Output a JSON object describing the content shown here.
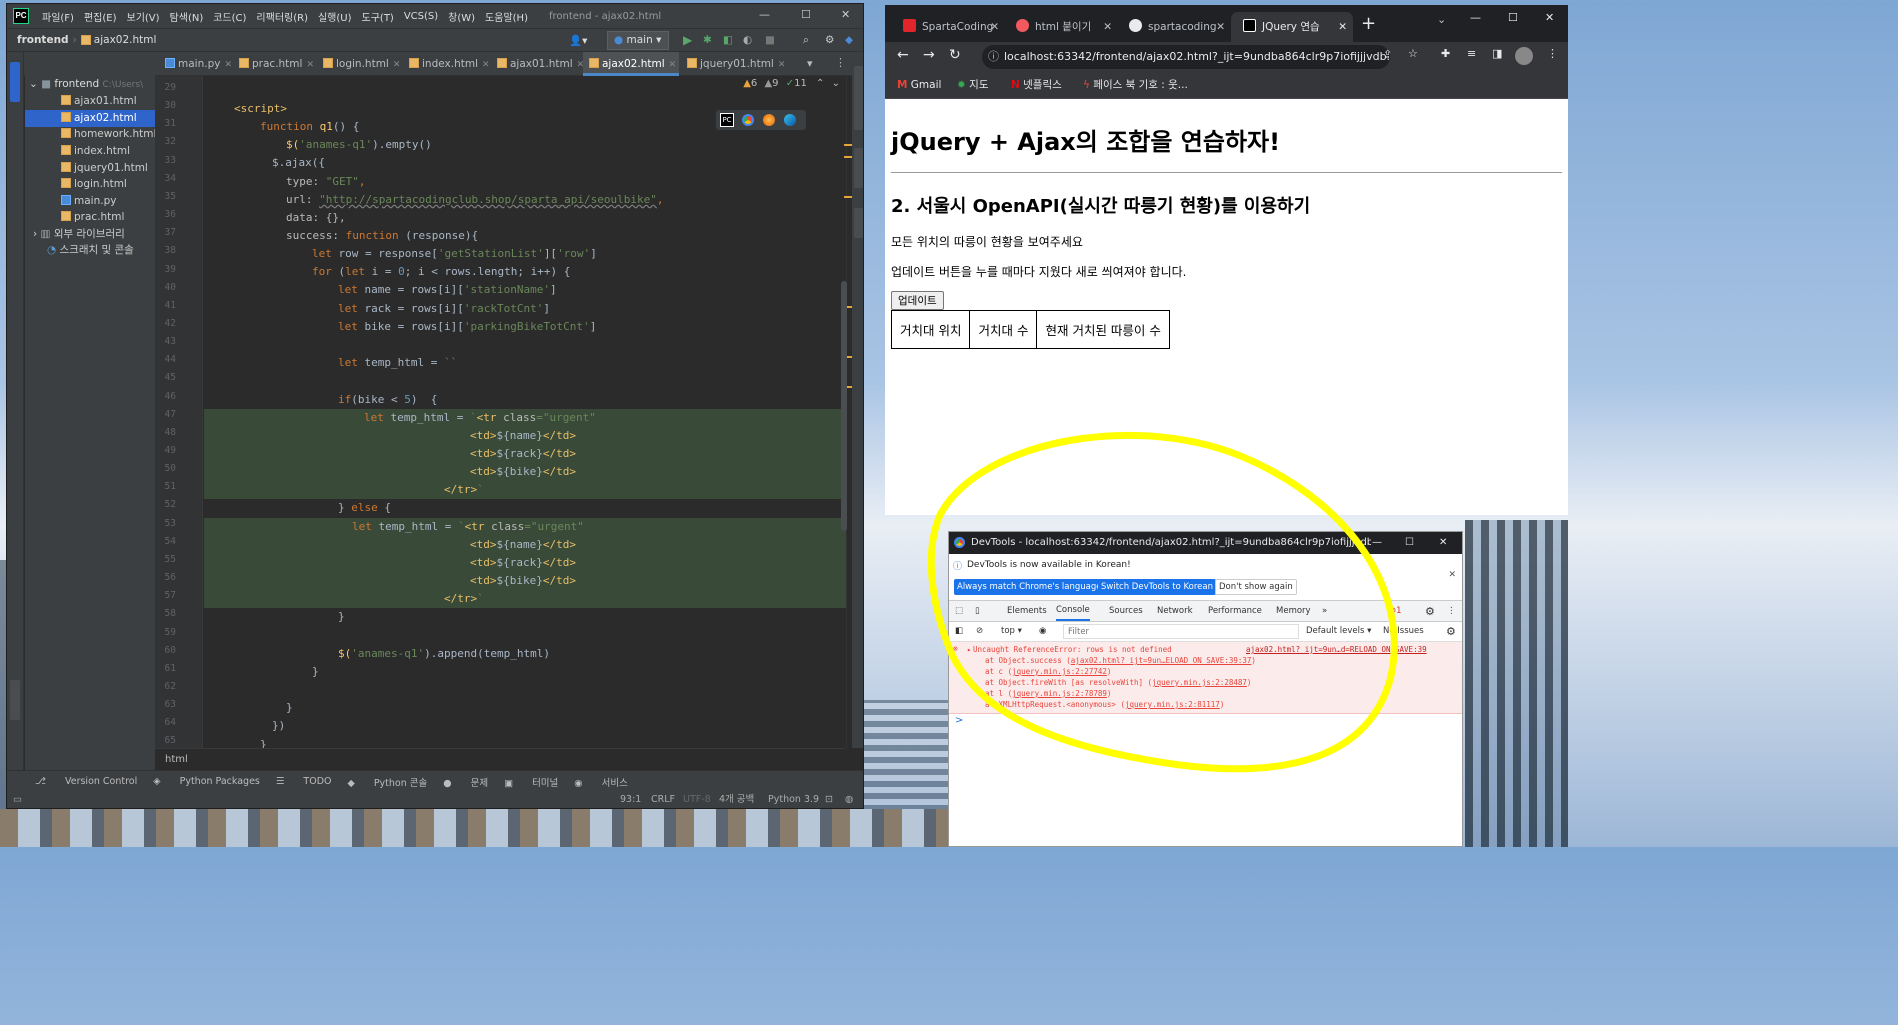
{
  "ide": {
    "menu": [
      "파일(F)",
      "편집(E)",
      "보기(V)",
      "탐색(N)",
      "코드(C)",
      "리팩터링(R)",
      "실행(U)",
      "도구(T)",
      "VCS(S)",
      "창(W)",
      "도움말(H)"
    ],
    "window_title": "frontend - ajax02.html",
    "nav": {
      "project": "frontend",
      "file": "ajax02.html",
      "run_config": "main"
    },
    "tabs": [
      {
        "label": "main.py",
        "py": true
      },
      {
        "label": "prac.html"
      },
      {
        "label": "login.html"
      },
      {
        "label": "index.html"
      },
      {
        "label": "ajax01.html"
      },
      {
        "label": "ajax02.html",
        "active": true
      },
      {
        "label": "jquery01.html"
      }
    ],
    "inspections": {
      "warnings": "6",
      "weak": "9",
      "typos": "11"
    },
    "project_tree": {
      "root": "frontend",
      "root_path": "C:\\Users\\",
      "files": [
        "ajax01.html",
        "ajax02.html",
        "homework.html",
        "index.html",
        "jquery01.html",
        "login.html",
        "main.py",
        "prac.html"
      ],
      "selected": "ajax02.html",
      "external": "외부 라이브러리",
      "scratch": "스크래치 및 콘솔"
    },
    "line_numbers": [
      "29",
      "30",
      "31",
      "32",
      "33",
      "34",
      "35",
      "36",
      "37",
      "38",
      "39",
      "40",
      "41",
      "42",
      "43",
      "44",
      "45",
      "46",
      "47",
      "48",
      "49",
      "50",
      "51",
      "52",
      "53",
      "54",
      "55",
      "56",
      "57",
      "58",
      "59",
      "60",
      "61",
      "62",
      "63",
      "64",
      "65"
    ],
    "code": {
      "l30": "<script>",
      "l31_kw": "function",
      "l31_fn": "q1",
      "l31_rest": "() {",
      "l32_a": "$(",
      "l32_s": "'anames-q1'",
      "l32_b": ").empty()",
      "l33": "$.ajax({",
      "l34_k": "type: ",
      "l34_v": "\"GET\"",
      "l34_c": ",",
      "l35_k": "url: ",
      "l35_v": "\"http://spartacodingclub.shop/sparta_api/seoulbike\"",
      "l35_c": ",",
      "l36": "data: {},",
      "l37_k": "success: ",
      "l37_kw": "function",
      "l37_rest": " (response){",
      "l38_kw": "let",
      "l38_a": " row = response[",
      "l38_s1": "'getStationList'",
      "l38_b": "][",
      "l38_s2": "'row'",
      "l38_c": "]",
      "l39_kw": "for",
      "l39_a": " (",
      "l39_kw2": "let",
      "l39_b": " i = ",
      "l39_n": "0",
      "l39_c": "; i < rows.length; i++) {",
      "l40_kw": "let",
      "l40_a": " name = rows[i][",
      "l40_s": "'stationName'",
      "l40_c": "]",
      "l41_kw": "let",
      "l41_a": " rack = rows[i][",
      "l41_s": "'rackTotCnt'",
      "l41_c": "]",
      "l42_kw": "let",
      "l42_a": " bike = rows[i][",
      "l42_s": "'parkingBikeTotCnt'",
      "l42_c": "]",
      "l44_kw": "let",
      "l44_a": " temp_html = ",
      "l44_s": "``",
      "l46_kw": "if",
      "l46_a": "(bike < ",
      "l46_n": "5",
      "l46_c": ")  {",
      "l47_kw": "let",
      "l47_a": " temp_html = ",
      "l47_q": "`",
      "l47_t": "<tr ",
      "l47_at": "class",
      "l47_v": "=\"urgent\"",
      "l48_t1": "<td>",
      "l48_v": "${name}",
      "l48_t2": "</td>",
      "l49_t1": "<td>",
      "l49_v": "${rack}",
      "l49_t2": "</td>",
      "l50_t1": "<td>",
      "l50_v": "${bike}",
      "l50_t2": "</td>",
      "l51_t": "</tr>",
      "l51_q": "`",
      "l52_a": "} ",
      "l52_kw": "else",
      "l52_b": " {",
      "l53_kw": "let",
      "l53_a": " temp_html = ",
      "l53_q": "`",
      "l53_t": "<tr ",
      "l53_at": "class",
      "l53_v": "=\"urgent\"",
      "l54_t1": "<td>",
      "l54_v": "${name}",
      "l54_t2": "</td>",
      "l55_t1": "<td>",
      "l55_v": "${rack}",
      "l55_t2": "</td>",
      "l56_t1": "<td>",
      "l56_v": "${bike}",
      "l56_t2": "</td>",
      "l57_t": "</tr>",
      "l57_q": "`",
      "l58": "}",
      "l60_a": "$(",
      "l60_s": "'anames-q1'",
      "l60_b": ").append(temp_html)",
      "l61": "}",
      "l63": "}",
      "l64": "})",
      "l65": "}"
    },
    "breadcrumb": "html",
    "tool_windows": [
      "Version Control",
      "Python Packages",
      "TODO",
      "Python 콘솔",
      "문제",
      "터미널",
      "서비스"
    ],
    "status": {
      "position": "93:1",
      "line_sep": "CRLF",
      "encoding": "UTF-8",
      "indent": "4개 공백",
      "interpreter": "Python 3.9"
    }
  },
  "browser": {
    "tabs": [
      {
        "label": "SpartaCoding",
        "color": "#e0262b"
      },
      {
        "label": "html 붙이기",
        "color": "#f25a60"
      },
      {
        "label": "spartacoding",
        "color": "#e8eaed"
      },
      {
        "label": "JQuery 연습",
        "color": "#000000",
        "active": true
      }
    ],
    "url": "localhost:63342/frontend/ajax02.html?_ijt=9undba864clr9p7iofijjjvdb...",
    "bookmarks": [
      "Gmail",
      "지도",
      "넷플릭스",
      "페이스 북 기호 : 웃..."
    ],
    "page": {
      "h1": "jQuery + Ajax의 조합을 연습하자!",
      "h2": "2. 서울시 OpenAPI(실시간 따릉기 현황)를 이용하기",
      "p1": "모든 위치의 따릉이 현황을 보여주세요",
      "p2": "업데이트 버튼을 누를 때마다 지웠다 새로 씌여져야 합니다.",
      "button": "업데이트",
      "table_headers": [
        "거치대 위치",
        "거치대 수",
        "현재 거치된 따릉이 수"
      ]
    }
  },
  "devtools": {
    "title": "DevTools - localhost:63342/frontend/ajax02.html?_ijt=9undba864clr9p7iofijjjvdbu&...",
    "infobar": "DevTools is now available in Korean!",
    "btn_match": "Always match Chrome's language",
    "btn_switch": "Switch DevTools to Korean",
    "btn_dont": "Don't show again",
    "tabs": [
      "Elements",
      "Console",
      "Sources",
      "Network",
      "Performance",
      "Memory"
    ],
    "error_count": "1",
    "context": "top",
    "filter_placeholder": "Filter",
    "levels": "Default levels",
    "issues": "No Issues",
    "error": {
      "message": "Uncaught ReferenceError: rows is not defined",
      "source": "ajax02.html?_ijt=9un…d=RELOAD_ON_SAVE:39",
      "stack": [
        {
          "pre": "at Object.success (",
          "link": "ajax02.html?_ijt=9un…ELOAD_ON_SAVE:39:37",
          "post": ")"
        },
        {
          "pre": "at c (",
          "link": "jquery.min.js:2:27742",
          "post": ")"
        },
        {
          "pre": "at Object.fireWith [as resolveWith] (",
          "link": "jquery.min.js:2:28487",
          "post": ")"
        },
        {
          "pre": "at l (",
          "link": "jquery.min.js:2:78789",
          "post": ")"
        },
        {
          "pre": "at XMLHttpRequest.<anonymous> (",
          "link": "jquery.min.js:2:81117",
          "post": ")"
        }
      ]
    },
    "prompt": ">"
  },
  "colors": {
    "accent": "#4a88c7",
    "error": "#e8453c",
    "highlight": "#ffff00"
  }
}
